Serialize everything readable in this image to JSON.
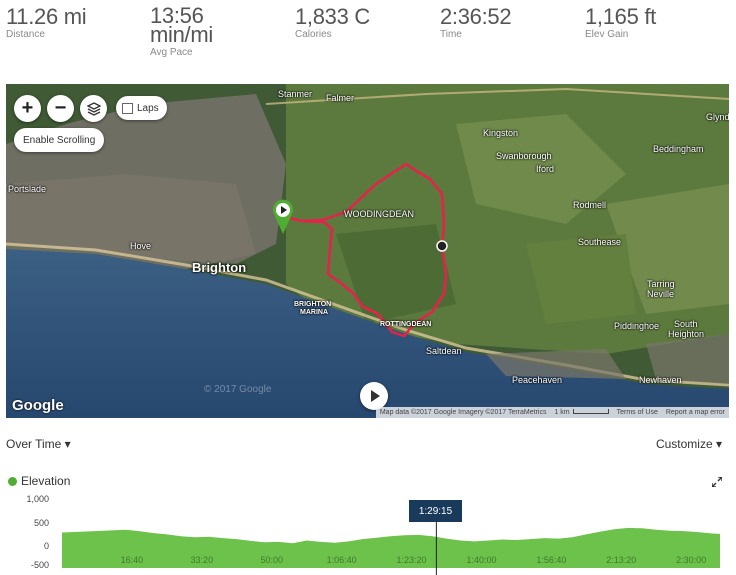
{
  "stats": [
    {
      "key": "distance",
      "value": "11.26 mi",
      "label": "Distance"
    },
    {
      "key": "pace",
      "value": "13:56",
      "value2": "min/mi",
      "label": "Avg Pace"
    },
    {
      "key": "calories",
      "value": "1,833 C",
      "label": "Calories"
    },
    {
      "key": "time",
      "value": "2:36:52",
      "label": "Time"
    },
    {
      "key": "elev",
      "value": "1,165 ft",
      "label": "Elev Gain"
    }
  ],
  "map": {
    "zoom_in": "+",
    "zoom_out": "−",
    "layers_icon": "layers-icon",
    "laps_label": "Laps",
    "enable_scrolling": "Enable Scrolling",
    "google_logo": "Google",
    "watermark": "© 2017 Google",
    "attribution": "Map data ©2017 Google Imagery ©2017 TerraMetrics",
    "scale": "1 km",
    "terms": "Terms of Use",
    "report": "Report a map error",
    "places": {
      "stanmer": "Stanmer",
      "falmer": "Falmer",
      "kingston": "Kingston",
      "swanborough": "Swanborough",
      "iford": "Iford",
      "beddingham": "Beddingham",
      "glynde": "Glynd",
      "portslade": "Portslade",
      "hove": "Hove",
      "brighton": "Brighton",
      "woodingdean": "WOODINGDEAN",
      "rodmell": "Rodmell",
      "southease": "Southease",
      "tarring": "Tarring",
      "neville": "Neville",
      "marina1": "BRIGHTON",
      "marina2": "MARINA",
      "rottingdean": "ROTTINGDEAN",
      "saltdean": "Saltdean",
      "piddinghoe": "Piddinghoe",
      "south": "South",
      "heighton": "Heighton",
      "peacehaven": "Peacehaven",
      "newhaven": "Newhaven"
    },
    "colors": {
      "route": "#e8204a",
      "start_pin": "#4fae32"
    }
  },
  "over_time": {
    "label": "Over Time ▾",
    "customize": "Customize ▾"
  },
  "chart_data": {
    "type": "area",
    "series": [
      {
        "name": "Elevation",
        "color": "#6cc24a"
      }
    ],
    "y_ticks": [
      "1,000",
      "500",
      "0",
      "-500"
    ],
    "ylim": [
      -500,
      1000
    ],
    "x_ticks": [
      "16:40",
      "33:20",
      "50:00",
      "1:06:40",
      "1:23:20",
      "1:40:00",
      "1:56:40",
      "2:13:20",
      "2:30:00"
    ],
    "x_tick_seconds": [
      1000,
      2000,
      3000,
      4000,
      5000,
      6000,
      7000,
      8000,
      9000
    ],
    "x_max_seconds": 9412,
    "points": [
      [
        0,
        260
      ],
      [
        300,
        280
      ],
      [
        600,
        300
      ],
      [
        900,
        320
      ],
      [
        1100,
        290
      ],
      [
        1300,
        250
      ],
      [
        1500,
        220
      ],
      [
        1700,
        180
      ],
      [
        1900,
        160
      ],
      [
        2100,
        170
      ],
      [
        2300,
        140
      ],
      [
        2500,
        120
      ],
      [
        2700,
        80
      ],
      [
        2900,
        50
      ],
      [
        3100,
        60
      ],
      [
        3300,
        30
      ],
      [
        3500,
        90
      ],
      [
        3700,
        60
      ],
      [
        3900,
        40
      ],
      [
        4100,
        70
      ],
      [
        4300,
        120
      ],
      [
        4500,
        150
      ],
      [
        4700,
        180
      ],
      [
        4900,
        200
      ],
      [
        5100,
        210
      ],
      [
        5300,
        180
      ],
      [
        5500,
        130
      ],
      [
        5700,
        90
      ],
      [
        5900,
        70
      ],
      [
        6100,
        90
      ],
      [
        6300,
        110
      ],
      [
        6500,
        100
      ],
      [
        6700,
        120
      ],
      [
        6900,
        140
      ],
      [
        7100,
        130
      ],
      [
        7300,
        160
      ],
      [
        7500,
        220
      ],
      [
        7700,
        280
      ],
      [
        7900,
        330
      ],
      [
        8100,
        360
      ],
      [
        8300,
        350
      ],
      [
        8500,
        320
      ],
      [
        8700,
        300
      ],
      [
        8900,
        290
      ],
      [
        9100,
        270
      ],
      [
        9300,
        240
      ],
      [
        9412,
        230
      ]
    ],
    "cursor_label": "1:29:15",
    "cursor_seconds": 5355
  },
  "expand_icon": "expand-icon"
}
